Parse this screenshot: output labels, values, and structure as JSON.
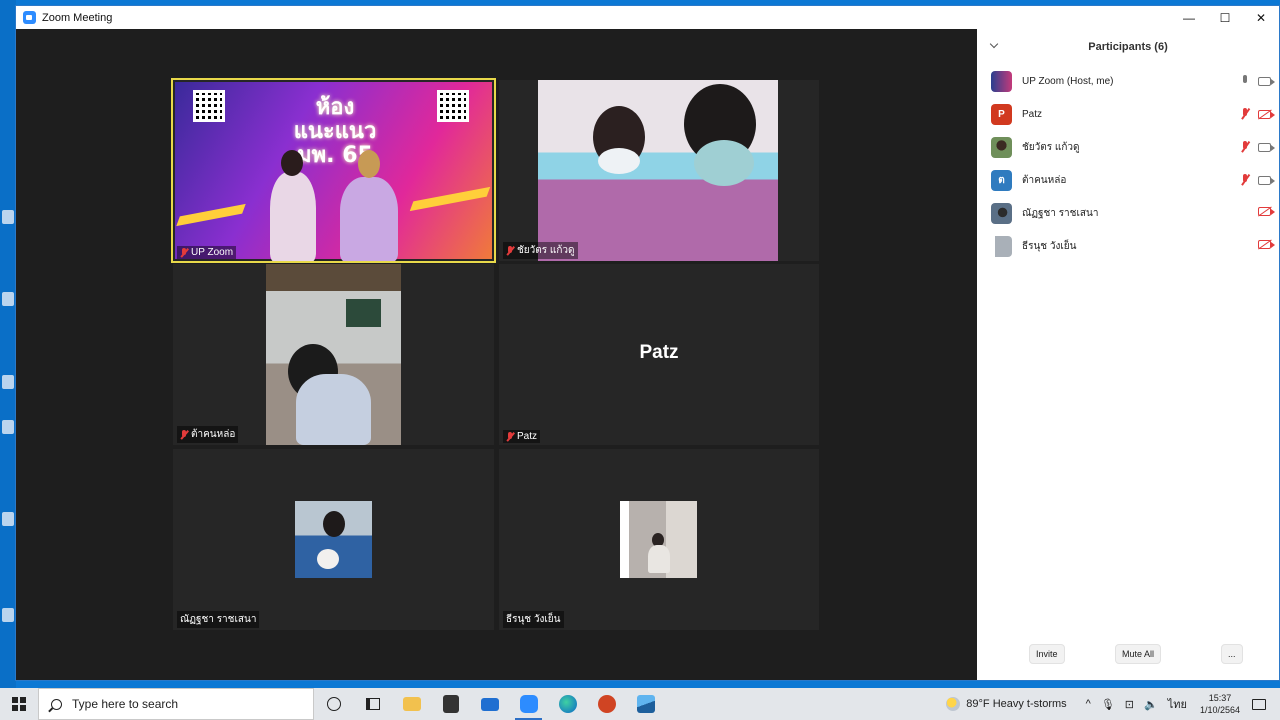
{
  "window": {
    "title": "Zoom Meeting",
    "controls": {
      "minimize": "—",
      "maximize": "☐",
      "close": "✕"
    }
  },
  "gallery": {
    "tiles": [
      {
        "name": "UP Zoom",
        "muted": true,
        "video": true,
        "active": true,
        "poster_title": "ห้องแนะแนว\nมพ. 65"
      },
      {
        "name": "ชัยวัตร แก้วดู",
        "muted": true,
        "video": true
      },
      {
        "name": "ต้าคนหล่อ",
        "muted": true,
        "video": true
      },
      {
        "name": "Patz",
        "muted": true,
        "video": false,
        "center_name": "Patz"
      },
      {
        "name": "ณัฏฐชา ราชเสนา",
        "muted": false,
        "video": true
      },
      {
        "name": "ธีรนุช วังเย็น",
        "muted": false,
        "video": true
      }
    ]
  },
  "participants": {
    "title": "Participants (6)",
    "list": [
      {
        "name": "UP Zoom (Host, me)",
        "avatar_letter": "",
        "avatar_color": "#ffffff",
        "mic_muted": false,
        "camera_off": false
      },
      {
        "name": "Patz",
        "avatar_letter": "P",
        "avatar_color": "#d1391f",
        "mic_muted": true,
        "camera_off": true
      },
      {
        "name": "ชัยวัตร แก้วดู",
        "avatar_letter": "",
        "avatar_color": "#6f8f5a",
        "mic_muted": true,
        "camera_off": false
      },
      {
        "name": "ต้าคนหล่อ",
        "avatar_letter": "ต",
        "avatar_color": "#2f7bbf",
        "mic_muted": true,
        "camera_off": false
      },
      {
        "name": "ณัฏฐชา ราชเสนา",
        "avatar_letter": "",
        "avatar_color": "#5a6f86",
        "mic_muted": false,
        "camera_off": true
      },
      {
        "name": "ธีรนุช วังเย็น",
        "avatar_letter": "",
        "avatar_color": "#a9b0b8",
        "mic_muted": false,
        "camera_off": true
      }
    ],
    "buttons": {
      "invite": "Invite",
      "mute_all": "Mute All",
      "more": "..."
    }
  },
  "taskbar": {
    "search_placeholder": "Type here to search",
    "weather": "89°F  Heavy t-storms",
    "language": "ไทย",
    "time": "15:37",
    "date": "1/10/2564"
  },
  "colors": {
    "accent": "#2d8cff",
    "active_speaker": "#e8d94a",
    "muted_red": "#e23b3b"
  }
}
